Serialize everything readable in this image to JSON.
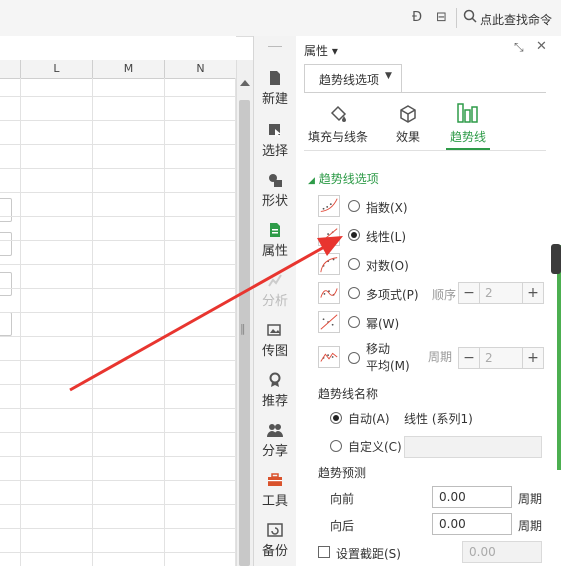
{
  "toolbar": {
    "search_label": "点此查找命令"
  },
  "sheet": {
    "columns": [
      "L",
      "M",
      "N"
    ]
  },
  "rail": {
    "items": [
      {
        "label": "新建",
        "icon": "new-icon"
      },
      {
        "label": "选择",
        "icon": "select-icon"
      },
      {
        "label": "形状",
        "icon": "shape-icon"
      },
      {
        "label": "属性",
        "icon": "property-icon"
      },
      {
        "label": "分析",
        "icon": "analysis-icon"
      },
      {
        "label": "传图",
        "icon": "upload-image-icon"
      },
      {
        "label": "推荐",
        "icon": "recommend-icon"
      },
      {
        "label": "分享",
        "icon": "share-icon"
      },
      {
        "label": "工具",
        "icon": "toolbox-icon"
      },
      {
        "label": "备份",
        "icon": "backup-icon"
      }
    ]
  },
  "panel": {
    "title": "属性 ▾",
    "tab_label": "趋势线选项",
    "sub_tabs": [
      "填充与线条",
      "效果",
      "趋势线"
    ],
    "section_title": "趋势线选项",
    "options": {
      "exp": "指数(X)",
      "linear": "线性(L)",
      "log": "对数(O)",
      "poly": "多项式(P)",
      "poly_order_label": "顺序",
      "poly_order_value": "2",
      "power": "幂(W)",
      "moving_avg_line1": "移动",
      "moving_avg_line2": "平均(M)",
      "period_label": "周期",
      "period_value": "2"
    },
    "name_section": {
      "title": "趋势线名称",
      "auto_label": "自动(A)",
      "auto_value": "线性 (系列1)",
      "custom_label": "自定义(C)"
    },
    "forecast": {
      "title": "趋势预测",
      "forward_label": "向前",
      "forward_value": "0.00",
      "forward_unit": "周期",
      "backward_label": "向后",
      "backward_value": "0.00",
      "backward_unit": "周期"
    },
    "intercept": {
      "label": "设置截距(S)",
      "value": "0.00"
    }
  },
  "colors": {
    "accent_green": "#2e9b48",
    "arrow_red": "#e8352f"
  }
}
